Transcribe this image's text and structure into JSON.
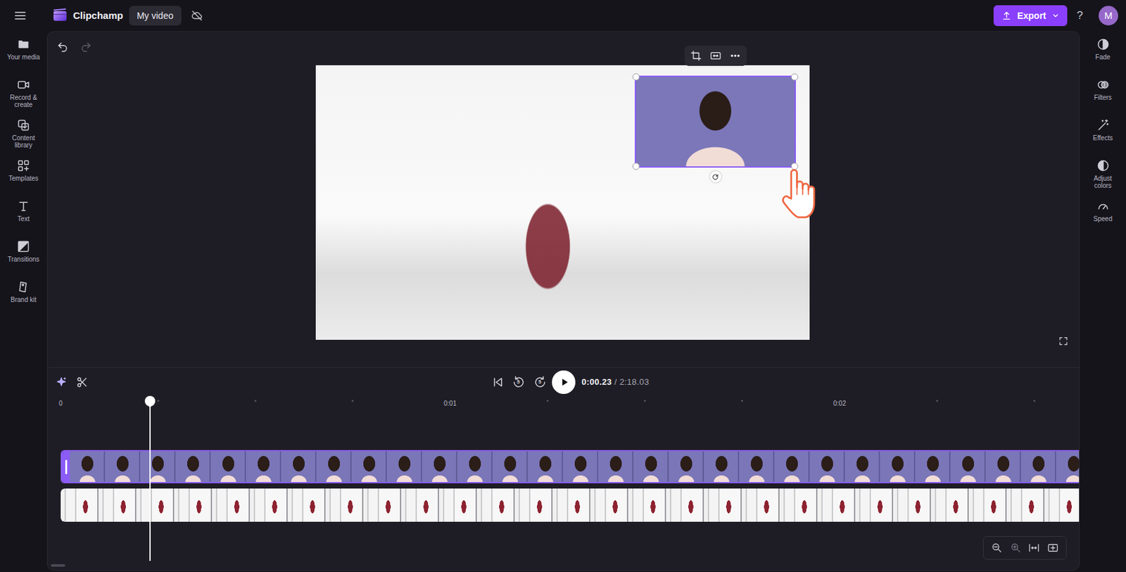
{
  "app": {
    "name": "Clipchamp",
    "project": "My video"
  },
  "header": {
    "export": "Export",
    "help": "?",
    "avatar": "M"
  },
  "left_sidebar": {
    "items": [
      {
        "label": "Your media"
      },
      {
        "label": "Record & create"
      },
      {
        "label": "Content library"
      },
      {
        "label": "Templates"
      },
      {
        "label": "Text"
      },
      {
        "label": "Transitions"
      },
      {
        "label": "Brand kit"
      }
    ]
  },
  "right_sidebar": {
    "items": [
      {
        "label": "Fade"
      },
      {
        "label": "Filters"
      },
      {
        "label": "Effects"
      },
      {
        "label": "Adjust colors"
      },
      {
        "label": "Speed"
      }
    ]
  },
  "preview": {
    "overlay": {
      "selected": true
    }
  },
  "transport": {
    "rewind": "5",
    "forward": "5",
    "playing": false,
    "current": "0:00.23",
    "separator": "/",
    "total": "2:18.03"
  },
  "timeline": {
    "ticks": [
      "0",
      "0:01",
      "0:02"
    ],
    "playhead": {
      "level": 0.088
    },
    "tracks": [
      {
        "kind": "overlay",
        "selected": true
      },
      {
        "kind": "main",
        "selected": false
      }
    ]
  }
}
